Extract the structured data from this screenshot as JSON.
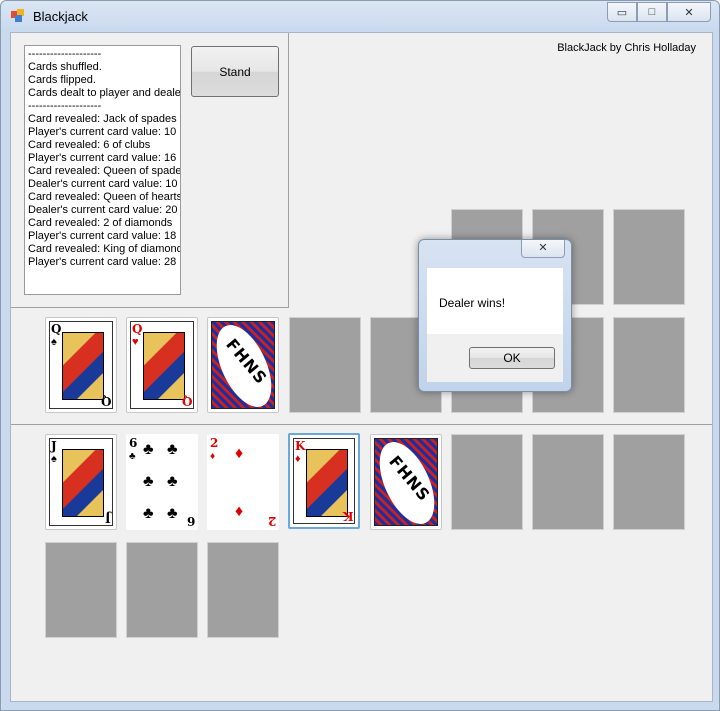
{
  "window": {
    "title": "Blackjack",
    "minimize_icon": "minimize-icon",
    "maximize_icon": "maximize-icon",
    "close_icon": "close-icon",
    "minimize_glyph": "▭",
    "maximize_glyph": "□",
    "close_glyph": "✕"
  },
  "credit": "BlackJack by Chris Holladay",
  "controls": {
    "stand_label": "Stand"
  },
  "log": {
    "lines": [
      "--------------------",
      "Cards shuffled.",
      "Cards flipped.",
      "Cards dealt to player and dealer.",
      "--------------------",
      "Card revealed: Jack of spades",
      "Player's current card value: 10",
      "Card revealed: 6 of clubs",
      "Player's current card value: 16",
      "Card revealed: Queen of spades",
      "Dealer's current card value: 10",
      "Card revealed: Queen of hearts",
      "Dealer's current card value: 20",
      "Card revealed: 2 of diamonds",
      "Player's current card value: 18",
      "Card revealed: King of diamonds",
      "Player's current card value: 28"
    ]
  },
  "dealer_hand": [
    {
      "rank": "Q",
      "suit": "♠",
      "color": "#000000",
      "face_up": true
    },
    {
      "rank": "Q",
      "suit": "♥",
      "color": "#e00000",
      "face_up": true
    },
    {
      "face_up": false,
      "back_text": "FHNS"
    }
  ],
  "player_hand": [
    {
      "rank": "J",
      "suit": "♠",
      "color": "#000000",
      "face_up": true
    },
    {
      "rank": "6",
      "suit": "♣",
      "color": "#000000",
      "face_up": true
    },
    {
      "rank": "2",
      "suit": "♦",
      "color": "#e00000",
      "face_up": true
    },
    {
      "rank": "K",
      "suit": "♦",
      "color": "#e00000",
      "face_up": true,
      "selected": true
    },
    {
      "face_up": false,
      "back_text": "FHNS"
    }
  ],
  "dialog": {
    "message": "Dealer wins!",
    "ok_label": "OK",
    "close_glyph": "✕"
  }
}
